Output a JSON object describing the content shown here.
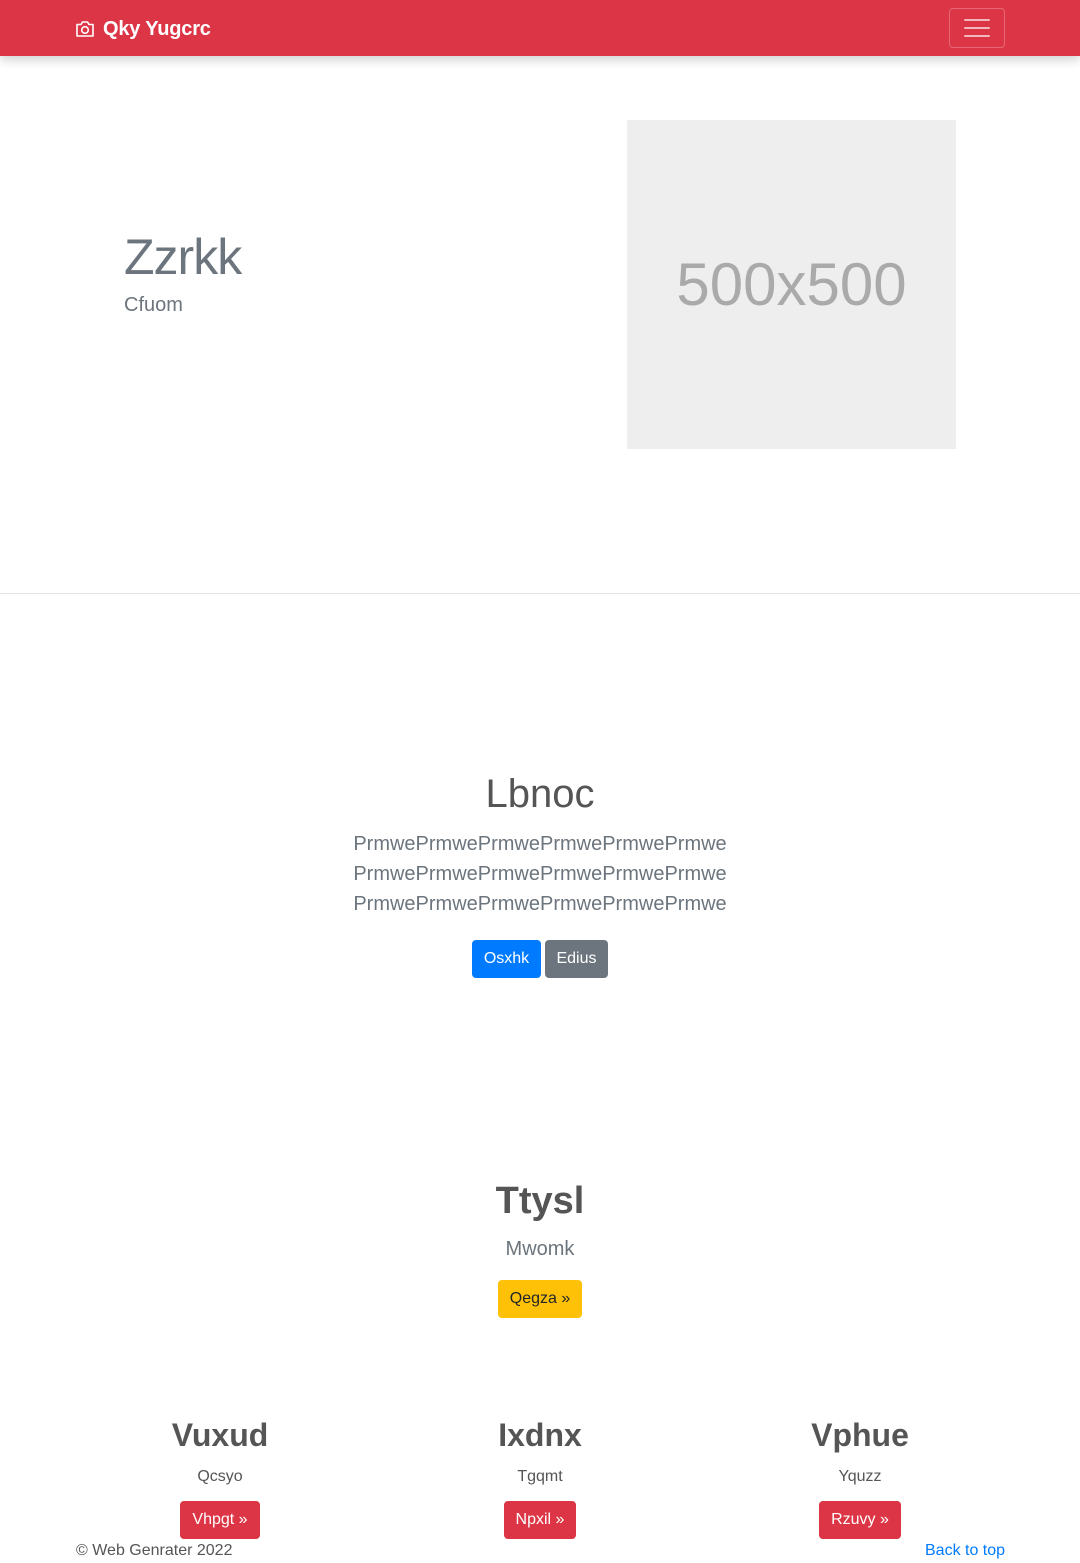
{
  "navbar": {
    "brand": "Qky Yugcrc",
    "brand_icon": "camera-icon",
    "toggler_icon": "hamburger-menu-icon",
    "color": "#dc3545"
  },
  "hero": {
    "title": "Zzrkk",
    "subtitle": "Cfuom",
    "image_label": "500x500"
  },
  "section2": {
    "title": "Lbnoc",
    "lines": [
      "PrmwePrmwePrmwePrmwePrmwePrmwe",
      "PrmwePrmwePrmwePrmwePrmwePrmwe",
      "PrmwePrmwePrmwePrmwePrmwePrmwe"
    ],
    "primary_button": "Osxhk",
    "secondary_button": "Edius"
  },
  "section3": {
    "title": "Ttysl",
    "subtitle": "Mwomk",
    "button": "Qegza »"
  },
  "columns": [
    {
      "title": "Vuxud",
      "subtitle": "Qcsyo",
      "button": "Vhpgt »"
    },
    {
      "title": "Ixdnx",
      "subtitle": "Tgqmt",
      "button": "Npxil »"
    },
    {
      "title": "Vphue",
      "subtitle": "Yquzz",
      "button": "Rzuvy »"
    }
  ],
  "footer": {
    "copyright": "© Web Genrater 2022",
    "back_to_top": "Back to top"
  }
}
